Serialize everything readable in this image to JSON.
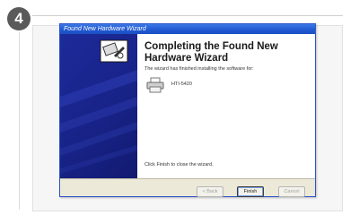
{
  "step": {
    "number": "4"
  },
  "dialog": {
    "title": "Found New Hardware Wizard",
    "heading": "Completing the Found New Hardware Wizard",
    "description": "The wizard has finished installing the software for:",
    "device_name": "HTI-5420",
    "close_hint": "Click Finish to close the wizard.",
    "buttons": {
      "back": "< Back",
      "finish": "Finish",
      "cancel": "Cancel"
    }
  },
  "colors": {
    "titlebar": "#1f58d0",
    "sidebar": "#182388",
    "badge": "#5a5a5a"
  },
  "icons": {
    "wizard": "hardware-wizard-icon",
    "device": "printer-icon"
  }
}
